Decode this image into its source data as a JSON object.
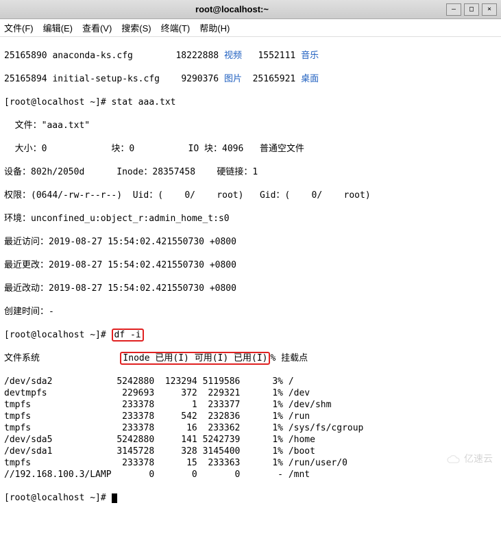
{
  "titlebar": {
    "title": "root@localhost:~"
  },
  "menu": {
    "file": "文件(F)",
    "edit": "编辑(E)",
    "view": "查看(V)",
    "search": "搜索(S)",
    "terminal": "终端(T)",
    "help": "帮助(H)"
  },
  "ls": {
    "r1c1": "25165890",
    "r1c2": "anaconda-ks.cfg",
    "r1c3": "18222888",
    "r1c4": "视频",
    "r1c5": "1552111",
    "r1c6": "音乐",
    "r2c1": "25165894",
    "r2c2": "initial-setup-ks.cfg",
    "r2c3": "9290376",
    "r2c4": "图片",
    "r2c5": "25165921",
    "r2c6": "桌面"
  },
  "stat_cmd": {
    "prompt": "[root@localhost ~]# ",
    "cmd": "stat aaa.txt"
  },
  "stat": {
    "file_lbl": "  文件：",
    "file_val": "\"aaa.txt\"",
    "size_lbl": "  大小：",
    "size_val": "0",
    "blocks_lbl": "块：",
    "blocks_val": "0",
    "ioblk_lbl": "IO 块：",
    "ioblk_val": "4096",
    "type": "普通空文件",
    "dev_lbl": "设备：",
    "dev_val": "802h/2050d",
    "inode_lbl": "Inode：",
    "inode_val": "28357458",
    "links_lbl": "硬链接：",
    "links_val": "1",
    "perm_lbl": "权限：",
    "perm_val": "(0644/-rw-r--r--)",
    "uid_lbl": "Uid：",
    "uid_val": "(    0/    root)",
    "gid_lbl": "Gid：",
    "gid_val": "(    0/    root)",
    "ctx_lbl": "环境：",
    "ctx_val": "unconfined_u:object_r:admin_home_t:s0",
    "atime_lbl": "最近访问：",
    "atime_val": "2019-08-27 15:54:02.421550730 +0800",
    "mtime_lbl": "最近更改：",
    "mtime_val": "2019-08-27 15:54:02.421550730 +0800",
    "ctime_lbl": "最近改动：",
    "ctime_val": "2019-08-27 15:54:02.421550730 +0800",
    "btime_lbl": "创建时间：",
    "btime_val": "-"
  },
  "df_cmd": {
    "prompt": "[root@localhost ~]# ",
    "cmd": "df -i"
  },
  "df_hdr": {
    "fs": "文件系统",
    "cols": "Inode 已用(I) 可用(I) 已用(I)",
    "pct": "%",
    "mnt": "挂载点"
  },
  "df": [
    {
      "fs": "/dev/sda2",
      "inodes": "5242880",
      "iused": "123294",
      "ifree": "5119586",
      "pct": "3%",
      "mnt": "/"
    },
    {
      "fs": "devtmpfs",
      "inodes": "229693",
      "iused": "372",
      "ifree": "229321",
      "pct": "1%",
      "mnt": "/dev"
    },
    {
      "fs": "tmpfs",
      "inodes": "233378",
      "iused": "1",
      "ifree": "233377",
      "pct": "1%",
      "mnt": "/dev/shm"
    },
    {
      "fs": "tmpfs",
      "inodes": "233378",
      "iused": "542",
      "ifree": "232836",
      "pct": "1%",
      "mnt": "/run"
    },
    {
      "fs": "tmpfs",
      "inodes": "233378",
      "iused": "16",
      "ifree": "233362",
      "pct": "1%",
      "mnt": "/sys/fs/cgroup"
    },
    {
      "fs": "/dev/sda5",
      "inodes": "5242880",
      "iused": "141",
      "ifree": "5242739",
      "pct": "1%",
      "mnt": "/home"
    },
    {
      "fs": "/dev/sda1",
      "inodes": "3145728",
      "iused": "328",
      "ifree": "3145400",
      "pct": "1%",
      "mnt": "/boot"
    },
    {
      "fs": "tmpfs",
      "inodes": "233378",
      "iused": "15",
      "ifree": "233363",
      "pct": "1%",
      "mnt": "/run/user/0"
    },
    {
      "fs": "//192.168.100.3/LAMP",
      "inodes": "0",
      "iused": "0",
      "ifree": "0",
      "pct": "-",
      "mnt": "/mnt"
    }
  ],
  "final_prompt": "[root@localhost ~]# ",
  "watermark": "亿速云"
}
